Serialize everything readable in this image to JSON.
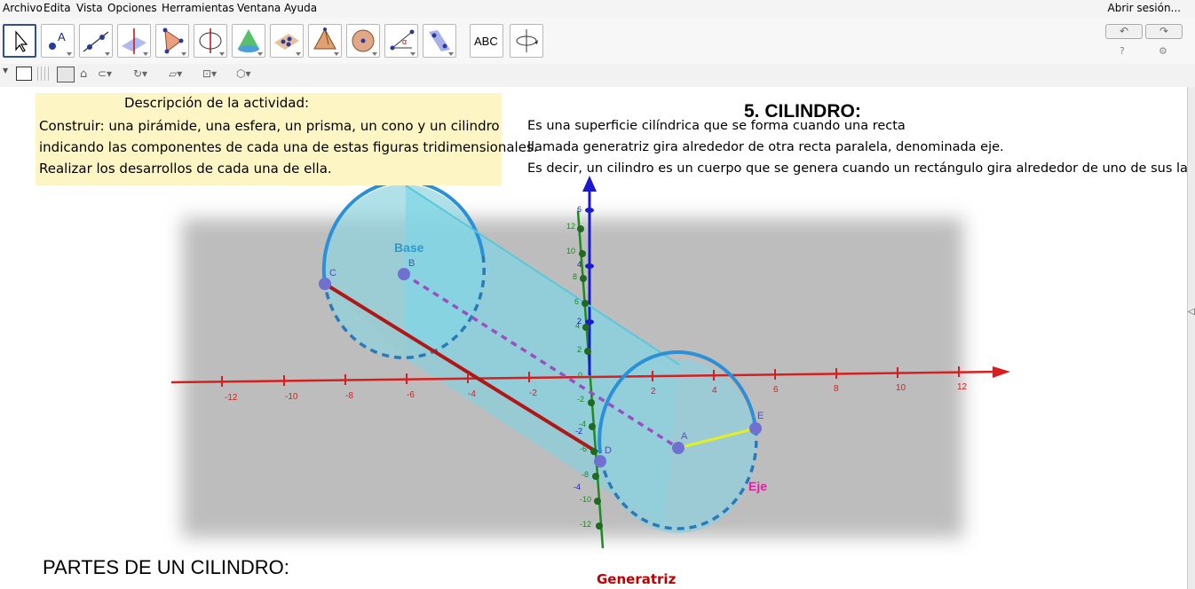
{
  "menu": {
    "items": [
      "Archivo",
      "Edita",
      "Vista",
      "Opciones",
      "Herramientas",
      "Ventana",
      "Ayuda"
    ],
    "signin": "Abrir sesión..."
  },
  "toolbar": {
    "tools": [
      "move-tool-icon",
      "point-tool-icon",
      "line-tool-icon",
      "perpendicular-tool-icon",
      "polygon-tool-icon",
      "circle-axis-tool-icon",
      "cone-tool-icon",
      "plane-points-tool-icon",
      "pyramid-tool-icon",
      "sphere-tool-icon",
      "angle-tool-icon",
      "reflect-plane-tool-icon",
      "text-tool-icon",
      "rotate-view-tool-icon"
    ],
    "text_tool_label": "ABC",
    "undo_icon": "undo-icon",
    "redo_icon": "redo-icon"
  },
  "description": {
    "title": "Descripción de la actividad:",
    "lines": [
      "Construir: una pirámide, una esfera, un prisma, un cono  y un cilindro",
      "indicando las componentes de cada una de estas figuras tridimensionales.",
      " Realizar los desarrollos de cada una de ella."
    ]
  },
  "section": {
    "heading": "5. CILINDRO:",
    "lines": [
      "Es una superficie cilíndrica que se forma cuando una recta",
      "llamada generatriz gira alrededor de otra recta paralela, denominada eje.",
      "Es decir, un cilindro es un cuerpo que se genera cuando un rectángulo gira alrededor de uno de sus lados."
    ]
  },
  "parts_title": "PARTES DE UN CILINDRO:",
  "graphic": {
    "labels": {
      "base": "Base",
      "eje": "Eje",
      "generatriz": "Generatriz"
    },
    "points": [
      "B",
      "A",
      "E",
      "C",
      "D"
    ],
    "x_ticks": [
      "-12",
      "-10",
      "-8",
      "-6",
      "-4",
      "-2",
      "2",
      "4",
      "6",
      "8",
      "10",
      "12"
    ],
    "y_ticks": [
      "12",
      "10",
      "8",
      "6",
      "4",
      "2",
      "0",
      "-2",
      "-4",
      "-6",
      "-8",
      "-10",
      "-12"
    ],
    "z_ticks": [
      "6",
      "4",
      "2",
      "-2",
      "-4"
    ],
    "colors": {
      "x_axis": "#d42020",
      "y_axis": "#1f8a1f",
      "z_axis": "#1a1acc",
      "cylinder": "#7fd6e6",
      "rim": "#2a90d8",
      "generatriz": "#b01818",
      "eje": "#9b4fc0",
      "radius": "#e0f020"
    }
  }
}
